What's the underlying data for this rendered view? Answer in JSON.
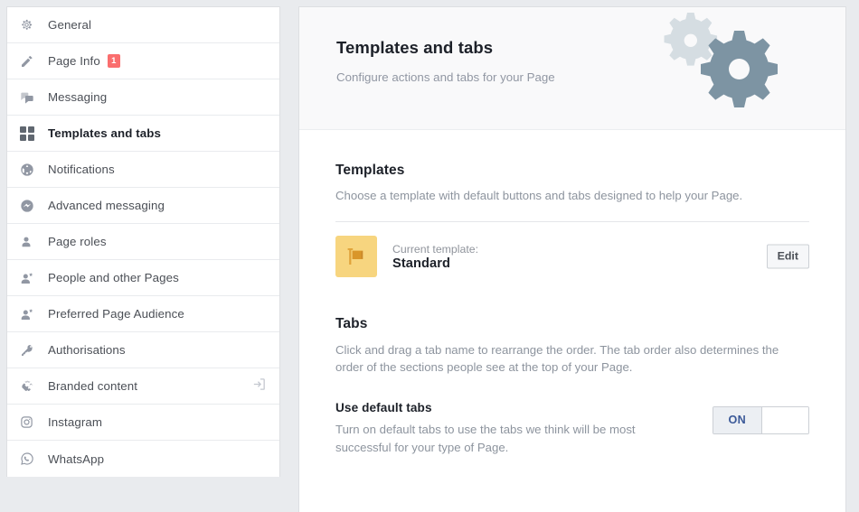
{
  "sidebar": {
    "items": [
      {
        "label": "General",
        "icon": "gear-icon",
        "active": false,
        "badge": null,
        "right_icon": null
      },
      {
        "label": "Page Info",
        "icon": "pencil-icon",
        "active": false,
        "badge": "1",
        "right_icon": null
      },
      {
        "label": "Messaging",
        "icon": "chat-bubbles-icon",
        "active": false,
        "badge": null,
        "right_icon": null
      },
      {
        "label": "Templates and tabs",
        "icon": "grid-squares-icon",
        "active": true,
        "badge": null,
        "right_icon": null
      },
      {
        "label": "Notifications",
        "icon": "globe-icon",
        "active": false,
        "badge": null,
        "right_icon": null
      },
      {
        "label": "Advanced messaging",
        "icon": "messenger-icon",
        "active": false,
        "badge": null,
        "right_icon": null
      },
      {
        "label": "Page roles",
        "icon": "person-icon",
        "active": false,
        "badge": null,
        "right_icon": null
      },
      {
        "label": "People and other Pages",
        "icon": "person-star-icon",
        "active": false,
        "badge": null,
        "right_icon": null
      },
      {
        "label": "Preferred Page Audience",
        "icon": "person-star-icon",
        "active": false,
        "badge": null,
        "right_icon": null
      },
      {
        "label": "Authorisations",
        "icon": "key-icon",
        "active": false,
        "badge": null,
        "right_icon": null
      },
      {
        "label": "Branded content",
        "icon": "handshake-icon",
        "active": false,
        "badge": null,
        "right_icon": "external-link-icon"
      },
      {
        "label": "Instagram",
        "icon": "instagram-icon",
        "active": false,
        "badge": null,
        "right_icon": null
      },
      {
        "label": "WhatsApp",
        "icon": "whatsapp-icon",
        "active": false,
        "badge": null,
        "right_icon": null
      }
    ]
  },
  "hero": {
    "title": "Templates and tabs",
    "subtitle": "Configure actions and tabs for your Page",
    "gear_light_color": "#d5dde2",
    "gear_dark_color": "#7d94a3"
  },
  "templates": {
    "title": "Templates",
    "description": "Choose a template with default buttons and tabs designed to help your Page.",
    "current_label": "Current template:",
    "current_name": "Standard",
    "thumb_color": "#f7d57f",
    "thumb_icon": "flag-icon",
    "edit_label": "Edit"
  },
  "tabs": {
    "title": "Tabs",
    "description": "Click and drag a tab name to rearrange the order. The tab order also determines the order of the sections people see at the top of your Page.",
    "default_tabs_label": "Use default tabs",
    "default_tabs_description": "Turn on default tabs to use the tabs we think will be most successful for your type of Page.",
    "toggle_on_label": "ON",
    "toggle_state": "on",
    "toggle_on_color": "#3b5998"
  }
}
